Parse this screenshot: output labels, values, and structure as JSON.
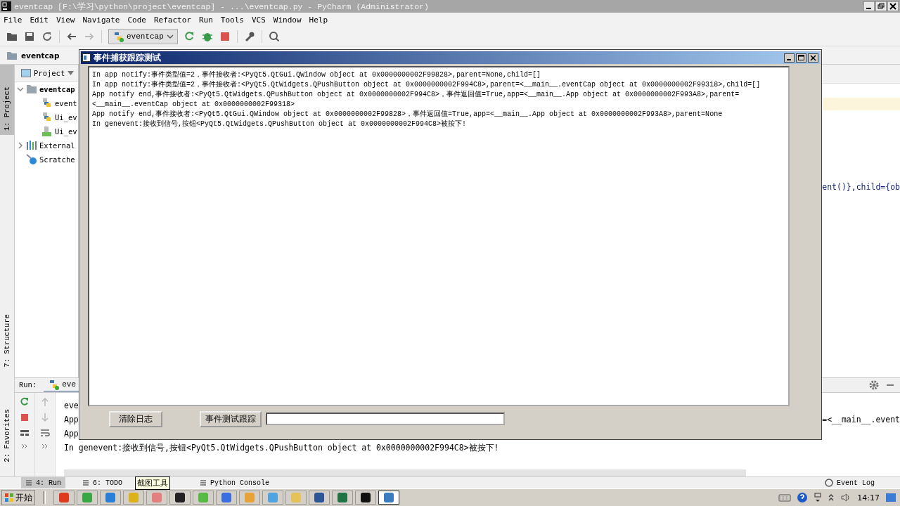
{
  "window": {
    "title": "eventcap [F:\\学习\\python\\project\\eventcap] - ...\\eventcap.py - PyCharm (Administrator)"
  },
  "menu": [
    "File",
    "Edit",
    "View",
    "Navigate",
    "Code",
    "Refactor",
    "Run",
    "Tools",
    "VCS",
    "Window",
    "Help"
  ],
  "toolbar": {
    "run_config": "eventcap"
  },
  "nav": {
    "project": "eventcap"
  },
  "side_tabs": [
    {
      "label": "1: Project",
      "selected": true
    },
    {
      "label": "7: Structure",
      "selected": false
    },
    {
      "label": "2: Favorites",
      "selected": false
    }
  ],
  "project": {
    "header": "Project",
    "tree": [
      {
        "label": "eventcap",
        "kind": "folder",
        "expanded": true,
        "children": [
          {
            "label": "event",
            "kind": "python"
          },
          {
            "label": "Ui_ev",
            "kind": "python"
          },
          {
            "label": "Ui_ev",
            "kind": "qt"
          }
        ]
      },
      {
        "label": "External",
        "kind": "library",
        "expanded": false
      },
      {
        "label": "Scratche",
        "kind": "scratch"
      }
    ]
  },
  "editor": {
    "code": "ent()},child={ob"
  },
  "run_panel": {
    "title": "Run:",
    "tab": "eve",
    "lines": [
      {
        "text": "eve"
      },
      {
        "text": "App",
        "tail": "=<__main__.event"
      },
      {
        "text": "App"
      },
      {
        "text": "In genevent:接收到信号,按钮<PyQt5.QtWidgets.QPushButton object at 0x0000000002F994C8>被按下!"
      }
    ]
  },
  "tool_tabs": [
    {
      "label": "4: Run",
      "selected": true
    },
    {
      "label": "6: TODO",
      "selected": false
    },
    {
      "label": "Python Console",
      "selected": false
    }
  ],
  "event_log": "Event Log",
  "tooltip": "截图工具",
  "dialog": {
    "title": "事件捕获跟踪测试",
    "log": [
      "In app notify:事件类型值=2，事件接收者:<PyQt5.QtGui.QWindow object at 0x0000000002F99828>,parent=None,child=[]",
      "In app notify:事件类型值=2，事件接收者:<PyQt5.QtWidgets.QPushButton object at 0x0000000002F994C8>,parent=<__main__.eventCap object at 0x0000000002F99318>,child=[]",
      "App notify end,事件接收者:<PyQt5.QtWidgets.QPushButton object at 0x0000000002F994C8>，事件返回值=True,app=<__main__.App object at 0x0000000002F993A8>,parent=<__main__.eventCap object at 0x0000000002F99318>",
      "App notify end,事件接收者:<PyQt5.QtGui.QWindow object at 0x0000000002F99828>，事件返回值=True,app=<__main__.App object at 0x0000000002F993A8>,parent=None",
      "In genevent:接收到信号,按钮<PyQt5.QtWidgets.QPushButton object at 0x0000000002F994C8>被按下!"
    ],
    "clear_button": "清除日志",
    "test_button": "事件测试跟踪"
  },
  "taskbar": {
    "start": "开始",
    "apps": [
      {
        "color": "#e03a1e",
        "selected": false
      },
      {
        "color": "#3aa745",
        "selected": false
      },
      {
        "color": "#2a7fd4",
        "selected": false
      },
      {
        "color": "#d9b21c",
        "selected": false
      },
      {
        "color": "#e27f7f",
        "selected": false
      },
      {
        "color": "#222222",
        "selected": false
      },
      {
        "color": "#58b947",
        "selected": false
      },
      {
        "color": "#3b6fe0",
        "selected": false
      },
      {
        "color": "#e8a23a",
        "selected": false
      },
      {
        "color": "#4fa3e0",
        "selected": false
      },
      {
        "color": "#e6c25a",
        "selected": false
      },
      {
        "color": "#2b5797",
        "selected": false
      },
      {
        "color": "#217346",
        "selected": false
      },
      {
        "color": "#111111",
        "selected": false
      },
      {
        "color": "#3b7bbf",
        "selected": true
      }
    ],
    "clock": "14:17"
  }
}
